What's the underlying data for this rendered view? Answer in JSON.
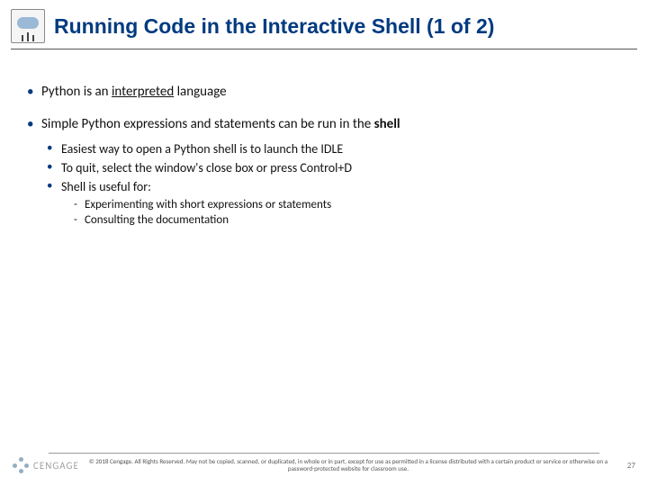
{
  "header": {
    "title": "Running Code in the Interactive Shell (1 of 2)"
  },
  "bullets": {
    "b1a_pre": "Python is an ",
    "b1a_u": "interpreted",
    "b1a_post": " language",
    "b1b_pre": "Simple Python expressions and statements can be run in the ",
    "b1b_bold": "shell",
    "b2a": "Easiest way to open a Python shell is to launch the IDLE",
    "b2b": "To quit, select the window's close box or press Control+D",
    "b2c": "Shell is useful for:",
    "b3a": "Experimenting with short expressions or statements",
    "b3b": "Consulting the documentation"
  },
  "footer": {
    "logo_text": "CENGAGE",
    "copyright": "© 2018 Cengage. All Rights Reserved. May not be copied, scanned, or duplicated, in whole or in part, except for use as permitted in a license distributed with a certain product or service or otherwise on a password-protected website for classroom use.",
    "page": "27"
  }
}
